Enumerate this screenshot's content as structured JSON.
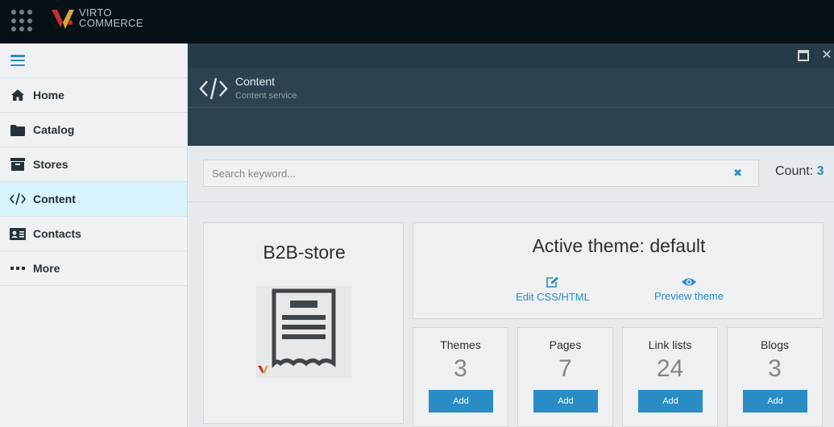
{
  "brand": {
    "line1": "VIRTO",
    "line2": "COMMERCE"
  },
  "sidebar": {
    "items": [
      {
        "label": "Home",
        "icon": "home-icon"
      },
      {
        "label": "Catalog",
        "icon": "folder-icon"
      },
      {
        "label": "Stores",
        "icon": "archive-icon"
      },
      {
        "label": "Content",
        "icon": "code-icon",
        "active": true
      },
      {
        "label": "Contacts",
        "icon": "contact-card-icon"
      },
      {
        "label": "More",
        "icon": "ellipsis-icon"
      }
    ]
  },
  "blade": {
    "title": "Content",
    "subtitle": "Content service",
    "search_placeholder": "Search keyword...",
    "count_label": "Count: ",
    "count_value": "3"
  },
  "store": {
    "name": "B2B-store"
  },
  "theme": {
    "title": "Active theme: default",
    "edit_label": "Edit CSS/HTML",
    "preview_label": "Preview theme"
  },
  "tiles": [
    {
      "label": "Themes",
      "value": "3",
      "button": "Add"
    },
    {
      "label": "Pages",
      "value": "7",
      "button": "Add"
    },
    {
      "label": "Link lists",
      "value": "24",
      "button": "Add"
    },
    {
      "label": "Blogs",
      "value": "3",
      "button": "Add"
    }
  ],
  "colors": {
    "accent": "#2a8cc4",
    "topbar": "#061017",
    "blade_header": "#2c4250",
    "active_nav": "#d9f4fd"
  }
}
